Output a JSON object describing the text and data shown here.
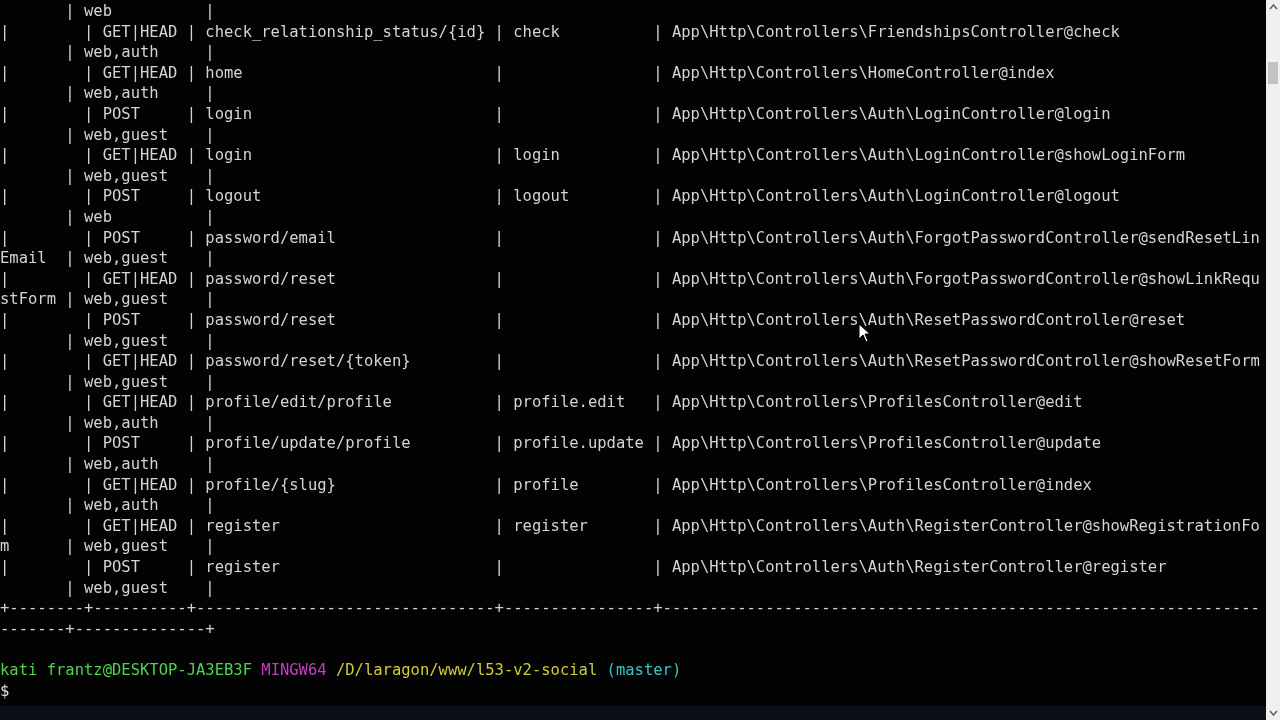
{
  "terminal": {
    "lines": [
      "       | web          |",
      "|        | GET|HEAD | check_relationship_status/{id} | check          | App\\Http\\Controllers\\FriendshipsController@check",
      "       | web,auth     |",
      "|        | GET|HEAD | home                           |                | App\\Http\\Controllers\\HomeController@index",
      "       | web,auth     |",
      "|        | POST     | login                          |                | App\\Http\\Controllers\\Auth\\LoginController@login",
      "       | web,guest    |",
      "|        | GET|HEAD | login                          | login          | App\\Http\\Controllers\\Auth\\LoginController@showLoginForm",
      "       | web,guest    |",
      "|        | POST     | logout                         | logout         | App\\Http\\Controllers\\Auth\\LoginController@logout",
      "       | web          |",
      "|        | POST     | password/email                 |                | App\\Http\\Controllers\\Auth\\ForgotPasswordController@sendResetLin",
      "Email  | web,guest    |",
      "|        | GET|HEAD | password/reset                 |                | App\\Http\\Controllers\\Auth\\ForgotPasswordController@showLinkRequ",
      "stForm | web,guest    |",
      "|        | POST     | password/reset                 |                | App\\Http\\Controllers\\Auth\\ResetPasswordController@reset",
      "       | web,guest    |",
      "|        | GET|HEAD | password/reset/{token}         |                | App\\Http\\Controllers\\Auth\\ResetPasswordController@showResetForm",
      "       | web,guest    |",
      "|        | GET|HEAD | profile/edit/profile           | profile.edit   | App\\Http\\Controllers\\ProfilesController@edit",
      "       | web,auth     |",
      "|        | POST     | profile/update/profile         | profile.update | App\\Http\\Controllers\\ProfilesController@update",
      "       | web,auth     |",
      "|        | GET|HEAD | profile/{slug}                 | profile        | App\\Http\\Controllers\\ProfilesController@index",
      "       | web,auth     |",
      "|        | GET|HEAD | register                       | register       | App\\Http\\Controllers\\Auth\\RegisterController@showRegistrationFo",
      "m      | web,guest    |",
      "|        | POST     | register                       |                | App\\Http\\Controllers\\Auth\\RegisterController@register",
      "       | web,guest    |",
      "+--------+----------+--------------------------------+----------------+----------------------------------------------------------------",
      "-------+--------------+"
    ],
    "prompt": {
      "user_host": "kati frantz@DESKTOP-JA3EB3F",
      "shell": "MINGW64",
      "path": "/D/laragon/www/l53-v2-social",
      "branch": "(master)",
      "symbol": "$"
    }
  }
}
